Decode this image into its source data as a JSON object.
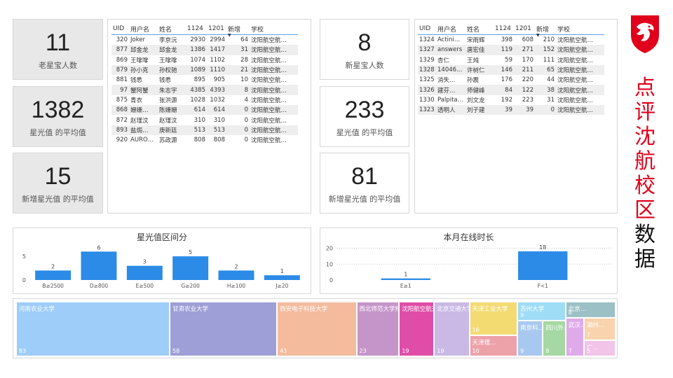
{
  "kpi": {
    "old_users": {
      "value": "11",
      "label": "老星宝人数"
    },
    "star_avg": {
      "value": "1382",
      "label": "星光值 的平均值"
    },
    "new_star_avg": {
      "value": "15",
      "label": "新增星光值 的平均值"
    },
    "new_users": {
      "value": "8",
      "label": "新星宝人数"
    },
    "star_avg2": {
      "value": "233",
      "label": "星光值 的平均值"
    },
    "new_star_avg2": {
      "value": "81",
      "label": "新增星光值 的平均值"
    }
  },
  "table1": {
    "headers": [
      "UID",
      "用户名",
      "姓名",
      "1124",
      "1201",
      "新增",
      "学校"
    ],
    "rows": [
      [
        "320",
        "Joker",
        "李京沅",
        "2930",
        "2994",
        "64",
        "沈阳航空航…"
      ],
      [
        "877",
        "邱金龙",
        "邱金龙",
        "1386",
        "1417",
        "31",
        "沈阳航空航…"
      ],
      [
        "869",
        "王嗱嗱",
        "王嗱嗱",
        "1074",
        "1102",
        "28",
        "沈阳航空航…"
      ],
      [
        "879",
        "孙小克",
        "孙权驰",
        "1089",
        "1110",
        "21",
        "沈阳航空航…"
      ],
      [
        "881",
        "钱悉",
        "钱悉",
        "895",
        "905",
        "10",
        "沈阳航空航…"
      ],
      [
        "97",
        "蟹阿蟹",
        "朱志宇",
        "4385",
        "4393",
        "8",
        "沈阳航空航…"
      ],
      [
        "875",
        "青衣",
        "张洪源",
        "1028",
        "1032",
        "4",
        "沈阳航空航…"
      ],
      [
        "868",
        "姗姗…",
        "陈姗姗",
        "614",
        "614",
        "0",
        "沈阳航空航…"
      ],
      [
        "872",
        "赵瑾汶",
        "赵瑾汶",
        "310",
        "310",
        "0",
        "沈阳航空航…"
      ],
      [
        "893",
        "盐焗…",
        "庚新廷",
        "513",
        "513",
        "0",
        "沈阳航空航…"
      ],
      [
        "920",
        "AURO…",
        "苏政源",
        "808",
        "808",
        "0",
        "沈阳航空航…"
      ]
    ]
  },
  "table2": {
    "headers": [
      "UID",
      "用户名",
      "姓名",
      "1124",
      "1201",
      "新增",
      "学校"
    ],
    "rows": [
      [
        "1324",
        "Actini…",
        "宋雨辉",
        "398",
        "608",
        "210",
        "沈阳航空航…"
      ],
      [
        "1327",
        "answers",
        "唐宏佳",
        "119",
        "271",
        "152",
        "沈阳航空航…"
      ],
      [
        "1329",
        "杏仁",
        "王炖",
        "59",
        "170",
        "111",
        "沈阳航空航…"
      ],
      [
        "1328",
        "14046…",
        "许树仁",
        "146",
        "211",
        "65",
        "沈阳航空航…"
      ],
      [
        "1325",
        "消失…",
        "孙震",
        "176",
        "220",
        "44",
        "沈阳航空航…"
      ],
      [
        "1326",
        "建芬…",
        "师健峰",
        "84",
        "122",
        "38",
        "沈阳航空航…"
      ],
      [
        "1330",
        "Palpita…",
        "刘文龙",
        "192",
        "223",
        "31",
        "沈阳航空航…"
      ],
      [
        "1323",
        "透明人",
        "刘子建",
        "39",
        "39",
        "0",
        "沈阳航空航…"
      ]
    ]
  },
  "chart_data": [
    {
      "type": "bar",
      "title": "星光值区间分",
      "categories": [
        "B≥2500",
        "D≥800",
        "E≥500",
        "G≥200",
        "H≥100",
        "J≥20"
      ],
      "values": [
        2,
        6,
        3,
        5,
        2,
        1
      ],
      "yticks": [
        0,
        5
      ],
      "ylim": [
        0,
        6.5
      ],
      "color": "#2b8be6"
    },
    {
      "type": "bar",
      "title": "本月在线时长",
      "categories": [
        "E≥1",
        "F<1"
      ],
      "values": [
        1,
        18
      ],
      "yticks": [
        0,
        10,
        20
      ],
      "ylim": [
        0,
        22
      ],
      "color": "#2b8be6"
    },
    {
      "type": "treemap",
      "items": [
        {
          "name": "河南农业大学",
          "value": 83,
          "color": "#9dcdf8"
        },
        {
          "name": "甘肃农业大学",
          "value": 58,
          "color": "#9e9fd6"
        },
        {
          "name": "西安电子科技大学",
          "value": 43,
          "color": "#f4bb9c"
        },
        {
          "name": "西北师范大学知行学院",
          "value": 23,
          "color": "#c595c9"
        },
        {
          "name": "沈阳航空航天大学",
          "value": 19,
          "color": "#e04da9"
        },
        {
          "name": "北京交通大学海滨…",
          "value": 19,
          "color": "#c9b9e4"
        },
        {
          "name": "天津工业大学",
          "value": 16,
          "color": "#f3db72"
        },
        {
          "name": "天津理…",
          "value": 10,
          "color": "#eda1a8"
        },
        {
          "name": "苏州大学",
          "value": 9,
          "color": "#9fdcf6"
        },
        {
          "name": "南京科…",
          "value": 9,
          "color": "#a8c8ef"
        },
        {
          "name": "四川外…",
          "value": 8,
          "color": "#a5d8a3"
        },
        {
          "name": "北京…",
          "value": 8,
          "color": "#9bc0c6"
        },
        {
          "name": "武汉…",
          "value": 7,
          "color": "#dfaaea"
        },
        {
          "name": "湖州…",
          "value": 7,
          "color": "#f8d3ad"
        },
        {
          "name": "广…",
          "value": 5,
          "color": "#f2c4e7"
        }
      ]
    }
  ],
  "side_title": {
    "chars": [
      "点",
      "评",
      "沈",
      "航",
      "校",
      "区",
      "数",
      "据"
    ],
    "red_count": 6,
    "red": "#e0001b",
    "black": "#111111"
  },
  "logo": {
    "icon": "dragon-shield-icon",
    "color": "#e0001b"
  }
}
